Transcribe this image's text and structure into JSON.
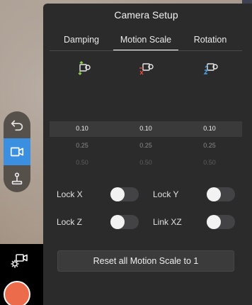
{
  "panel": {
    "title": "Camera Setup",
    "tabs": [
      {
        "label": "Damping",
        "active": false
      },
      {
        "label": "Motion Scale",
        "active": true
      },
      {
        "label": "Rotation",
        "active": false
      }
    ],
    "columns": [
      {
        "axis": "Y",
        "icon": "axis-y-icon",
        "color": "#8fd14f",
        "values": [
          "0.10",
          "0.25",
          "0.50"
        ]
      },
      {
        "axis": "X",
        "icon": "axis-x-icon",
        "color": "#e0483a",
        "values": [
          "0.10",
          "0.25",
          "0.50"
        ]
      },
      {
        "axis": "Z",
        "icon": "axis-z-icon",
        "color": "#4aa3e8",
        "values": [
          "0.10",
          "0.25",
          "0.50"
        ]
      }
    ],
    "toggles": [
      {
        "label": "Lock X",
        "on": false
      },
      {
        "label": "Lock Y",
        "on": false
      },
      {
        "label": "Lock Z",
        "on": false
      },
      {
        "label": "Link XZ",
        "on": false
      }
    ],
    "reset_label": "Reset all Motion Scale to 1"
  },
  "left_controls": {
    "items": [
      {
        "icon": "undo-icon",
        "active": false
      },
      {
        "icon": "video-camera-icon",
        "active": true
      },
      {
        "icon": "joystick-icon",
        "active": false
      }
    ],
    "settings_icon": "camera-settings-icon",
    "record_icon": "record-button"
  },
  "colors": {
    "panel_bg": "#2b2b2c",
    "accent_blue": "#3a8fe0",
    "record": "#ec6b4b"
  }
}
